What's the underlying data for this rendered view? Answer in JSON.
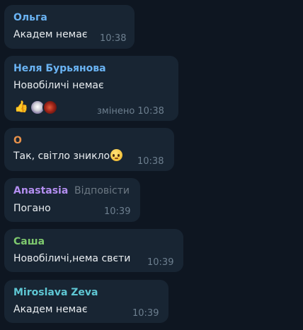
{
  "messages": [
    {
      "sender": "Ольга",
      "sender_color": "#6ab3f3",
      "text": "Академ немає",
      "time": "10:38"
    },
    {
      "sender": "Неля Бурьянова",
      "sender_color": "#6ab3f3",
      "text": "Новобіличі немає",
      "time": "змінено 10:38",
      "reactions": [
        "thumbs-up-icon",
        "avatar-reaction",
        "avatar-reaction"
      ]
    },
    {
      "sender": "О",
      "sender_color": "#e8914a",
      "text": "Так, світло зникло",
      "emoji": "pleading-face-icon",
      "time": "10:38"
    },
    {
      "sender": "Anastasia",
      "sender_color": "#b38ef0",
      "reply_label": "Відповісти",
      "text": "Погано",
      "time": "10:39"
    },
    {
      "sender": "Саша",
      "sender_color": "#7ec96e",
      "text": "Новобіличі,нема свєти",
      "time": "10:39"
    },
    {
      "sender": "Miroslava Zeva",
      "sender_color": "#5fc7d4",
      "text": "Академ немає",
      "time": "10:39"
    }
  ]
}
